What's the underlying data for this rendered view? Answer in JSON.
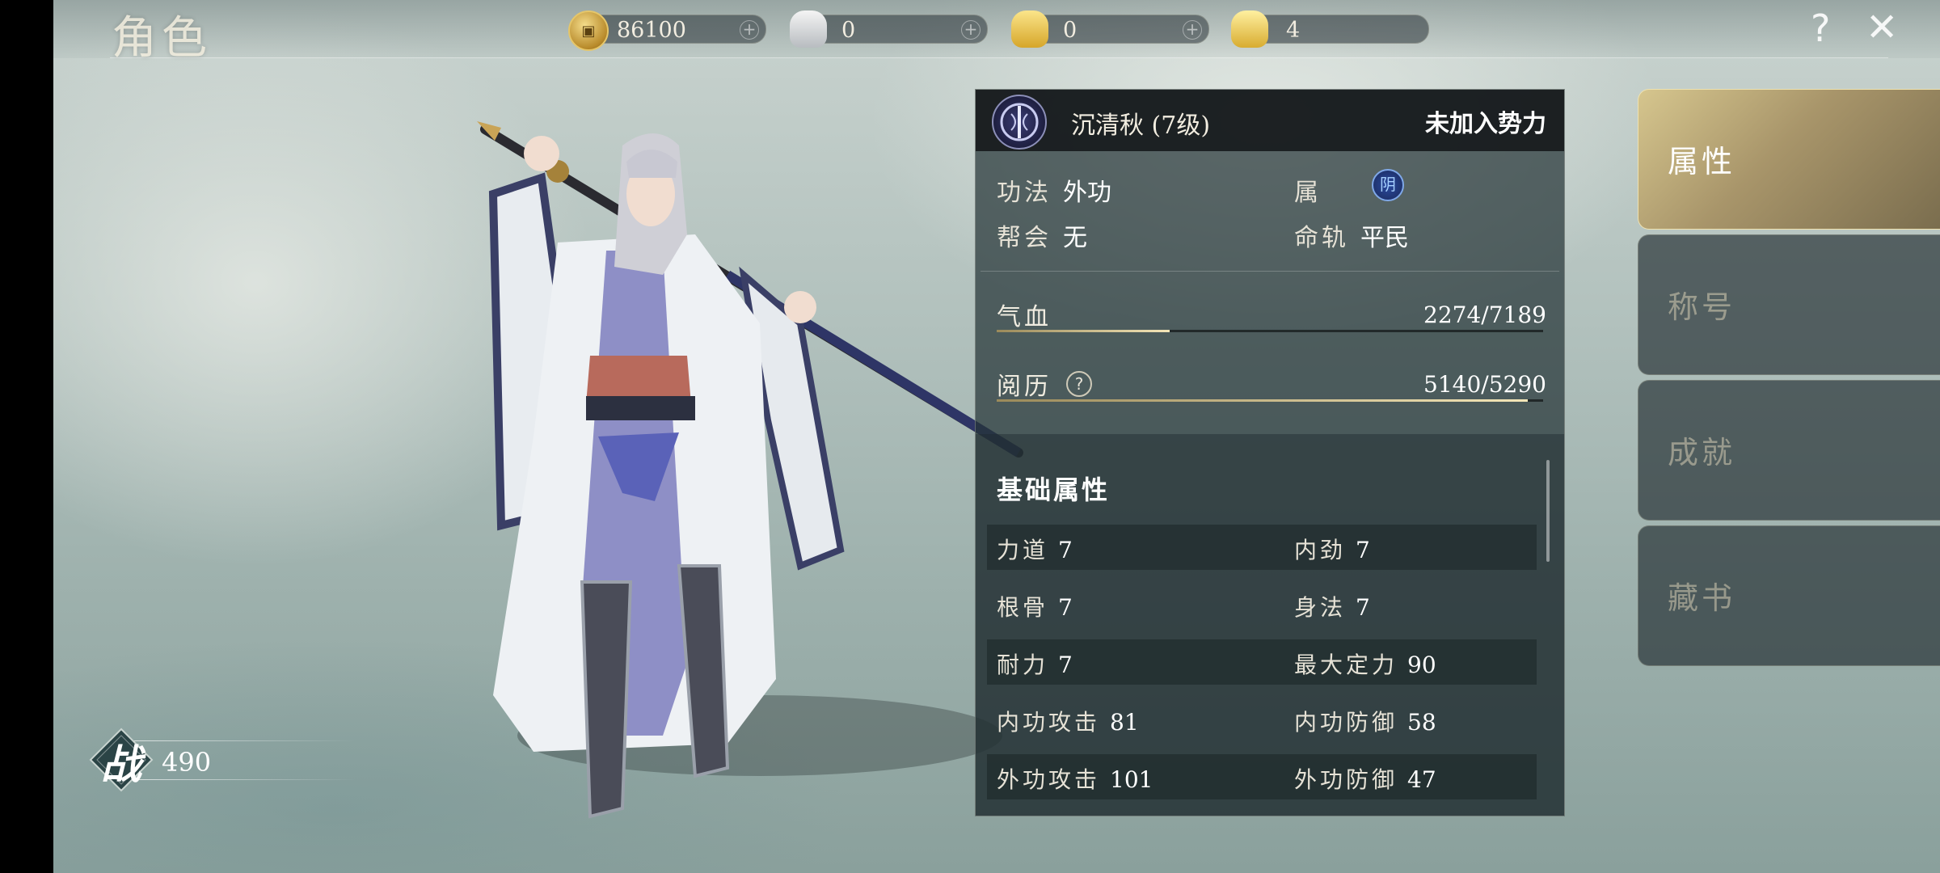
{
  "header": {
    "title": "角色"
  },
  "currencies": [
    {
      "icon": "copper-coin-icon",
      "value": "86100"
    },
    {
      "icon": "silver-ingot-icon",
      "value": "0"
    },
    {
      "icon": "gold-ingot-icon",
      "value": "0"
    },
    {
      "icon": "yuanbao-icon",
      "value": "4"
    }
  ],
  "controls": {
    "help": "?",
    "close": "✕"
  },
  "power": {
    "label": "战",
    "value": "490"
  },
  "profile": {
    "name": "沉清秋 (7级)",
    "faction": "未加入势力",
    "method_label": "功法",
    "method_value": "外功",
    "element_label": "属",
    "element_value": "阴",
    "guild_label": "帮会",
    "guild_value": "无",
    "fate_label": "命轨",
    "fate_value": "平民"
  },
  "bars": {
    "hp": {
      "label": "气血",
      "value": "2274/7189",
      "fraction": 0.316
    },
    "exp": {
      "label": "阅历",
      "value": "5140/5290",
      "fraction": 0.972
    }
  },
  "basic": {
    "title": "基础属性",
    "rows": [
      {
        "left_k": "力道",
        "left_v": "7",
        "right_k": "内劲",
        "right_v": "7"
      },
      {
        "left_k": "根骨",
        "left_v": "7",
        "right_k": "身法",
        "right_v": "7"
      },
      {
        "left_k": "耐力",
        "left_v": "7",
        "right_k": "最大定力",
        "right_v": "90"
      },
      {
        "left_k": "内功攻击",
        "left_v": "81",
        "right_k": "内功防御",
        "right_v": "58"
      },
      {
        "left_k": "外功攻击",
        "left_v": "101",
        "right_k": "外功防御",
        "right_v": "47"
      }
    ]
  },
  "tabs": [
    {
      "label": "属性",
      "active": true
    },
    {
      "label": "称号",
      "active": false
    },
    {
      "label": "成就",
      "active": false
    },
    {
      "label": "藏书",
      "active": false
    }
  ],
  "colors": {
    "accent_gold": "#d6c68e",
    "panel": "#26343a",
    "bar_fill": "#f4e6b8"
  }
}
